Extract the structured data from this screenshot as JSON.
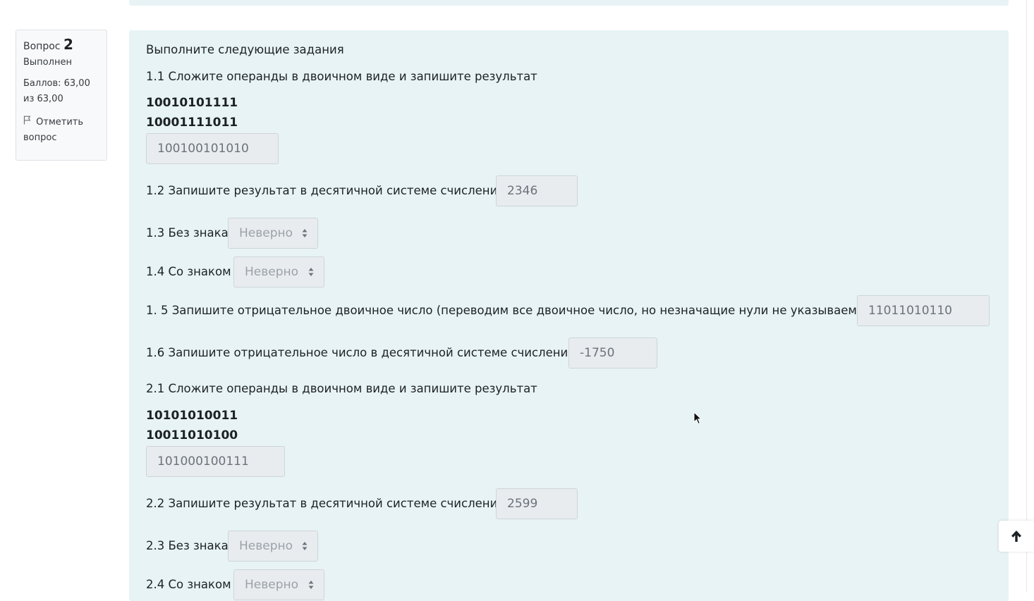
{
  "info": {
    "question_label": "Вопрос",
    "question_number": "2",
    "state": "Выполнен",
    "grade_line1": "Баллов: 63,00",
    "grade_line2": "из 63,00",
    "flag_line1": "Отметить",
    "flag_line2": "вопрос"
  },
  "question": {
    "intro": "Выполните следующие задания",
    "t1_1": "1.1 Сложите операнды в двоичном виде и запишите результат",
    "op1_a": "10010101111",
    "op1_b": "10001111011",
    "ans1_1": "100100101010",
    "t1_2": "1.2 Запишите результат в десятичной системе счисления",
    "ans1_2": "2346",
    "t1_3": "1.3 Без знака",
    "sel1_3": "Неверно",
    "t1_4": "1.4 Со знаком",
    "sel1_4": "Неверно",
    "t1_5": "1. 5 Запишите отрицательное двоичное число (переводим все двоичное число, но незначащие нули не указываем)",
    "ans1_5": "11011010110",
    "t1_6": "1.6 Запишите отрицательное число в десятичной системе счисления",
    "ans1_6": "-1750",
    "t2_1": "2.1 Сложите операнды в двоичном виде и запишите результат",
    "op2_a": "10101010011",
    "op2_b": "10011010100",
    "ans2_1": "101000100111",
    "t2_2": "2.2 Запишите результат в десятичной системе счисления",
    "ans2_2": "2599",
    "t2_3": "2.3 Без знака",
    "sel2_3": "Неверно",
    "t2_4": "2.4 Со знаком",
    "sel2_4": "Неверно"
  },
  "icons": {
    "flag": "flag-icon",
    "select_caret": "sort-caret-icon",
    "back_to_top": "arrow-up-icon",
    "cursor": "mouse-cursor-icon"
  },
  "colors": {
    "question_bg": "#e7f3f5",
    "input_bg": "#e9ecef",
    "info_bg": "#f8f9fa"
  }
}
